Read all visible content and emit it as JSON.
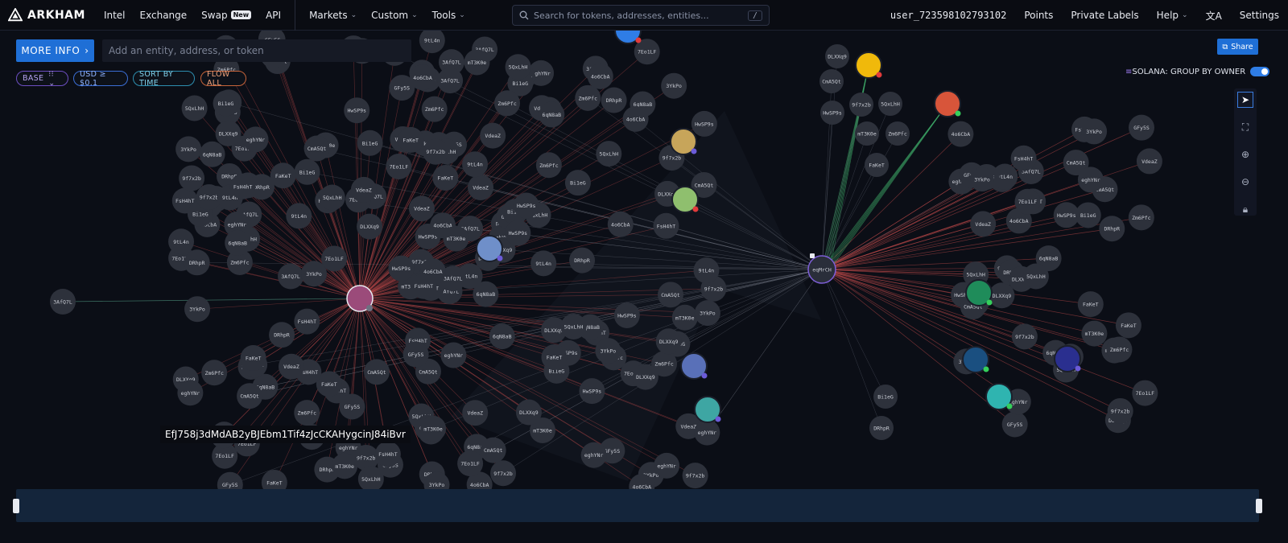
{
  "app": {
    "name": "ARKHAM"
  },
  "nav": {
    "items": [
      {
        "label": "Intel"
      },
      {
        "label": "Exchange"
      },
      {
        "label": "Swap",
        "badge": "New"
      },
      {
        "label": "API"
      }
    ],
    "dropdowns": [
      {
        "label": "Markets"
      },
      {
        "label": "Custom"
      },
      {
        "label": "Tools"
      }
    ],
    "search": {
      "placeholder": "Search for tokens, addresses, entities...",
      "shortcut": "/"
    },
    "user": "user_723598102793102",
    "right": [
      {
        "label": "Points"
      },
      {
        "label": "Private Labels"
      },
      {
        "label": "Help"
      },
      {
        "label": "Settings"
      }
    ]
  },
  "toolbar": {
    "more_info": "MORE INFO",
    "entity_placeholder": "Add an entity, address, or token",
    "filters": {
      "base": "BASE",
      "usd": "USD ≥ $0.1",
      "sort": "SORT BY TIME",
      "flow": "FLOW ALL"
    },
    "share": "Share",
    "solana_chain": "SOLANA",
    "group_by_owner": ": GROUP BY OWNER",
    "group_by_owner_on": true
  },
  "graph": {
    "hover_address": "EfJ758j3dMdAB2yBJEbm1Tif4zJcCKAHygcinJ84iBvr",
    "hub_left_label": "",
    "hub_right_label": "eqMrCH",
    "sample_labels": [
      "3AfQ7L",
      "7Eo1LF",
      "9tL4n",
      "Bi1eG",
      "DRhpR",
      "FsH4hT",
      "eghYNr",
      "GFy5S",
      "4o6CbA",
      "DLXXq9",
      "CmA5Qt",
      "9f7x2b",
      "5QxLhH",
      "HwSP9s",
      "mT3K0e",
      "Zm6Pfc",
      "FaKeT",
      "3YkPo",
      "VdeaZ",
      "6qN8aB"
    ],
    "node_colors": {
      "node": "#2d313b",
      "edge_out": "#c14a4a",
      "edge_in": "#3fae6a",
      "hub_ring": "#7e5fd8"
    }
  },
  "timeline": {}
}
